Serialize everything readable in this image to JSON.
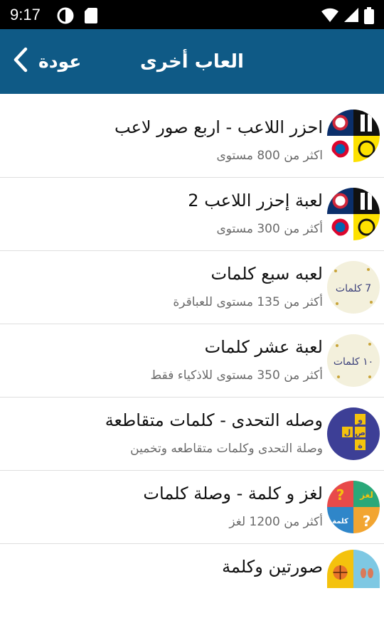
{
  "status_bar": {
    "time": "9:17"
  },
  "app_bar": {
    "title": "العاب أخرى",
    "back_label": "عودة"
  },
  "games": [
    {
      "title": "احزر اللاعب - اربع صور لاعب",
      "subtitle": "اكثر من 800 مستوى",
      "icon": "football-clubs-icon"
    },
    {
      "title": "لعبة إحزر اللاعب 2",
      "subtitle": "أكثر من 300 مستوى",
      "icon": "football-clubs-icon"
    },
    {
      "title": "لعبه سبع كلمات",
      "subtitle": "أكثر من 135 مستوى للعباقرة",
      "icon": "seven-words-icon",
      "icon_text": "7 كلمات"
    },
    {
      "title": "لعبة عشر كلمات",
      "subtitle": "أكثر من 350 مستوى للاذكياء فقط",
      "icon": "ten-words-icon",
      "icon_text": "١٠ كلمات"
    },
    {
      "title": "وصله التحدى - كلمات متقاطعة",
      "subtitle": "وصلة التحدى وكلمات متقاطعه وتخمين",
      "icon": "crossword-icon",
      "icon_letters": [
        "و",
        "ص",
        "ل",
        "ة"
      ]
    },
    {
      "title": "لغز و كلمة - وصلة كلمات",
      "subtitle": "أكثر من 1200 لغز",
      "icon": "puzzle-word-icon",
      "icon_text_a": "لغز",
      "icon_text_b": "كلمة",
      "icon_q": "?"
    },
    {
      "title": "صورتين وكلمة",
      "subtitle": "",
      "icon": "two-pictures-icon"
    }
  ],
  "colors": {
    "app_bar": "#0f5a86",
    "status_bar": "#000000",
    "title_text": "#111111",
    "subtitle_text": "#6a6a6a"
  }
}
